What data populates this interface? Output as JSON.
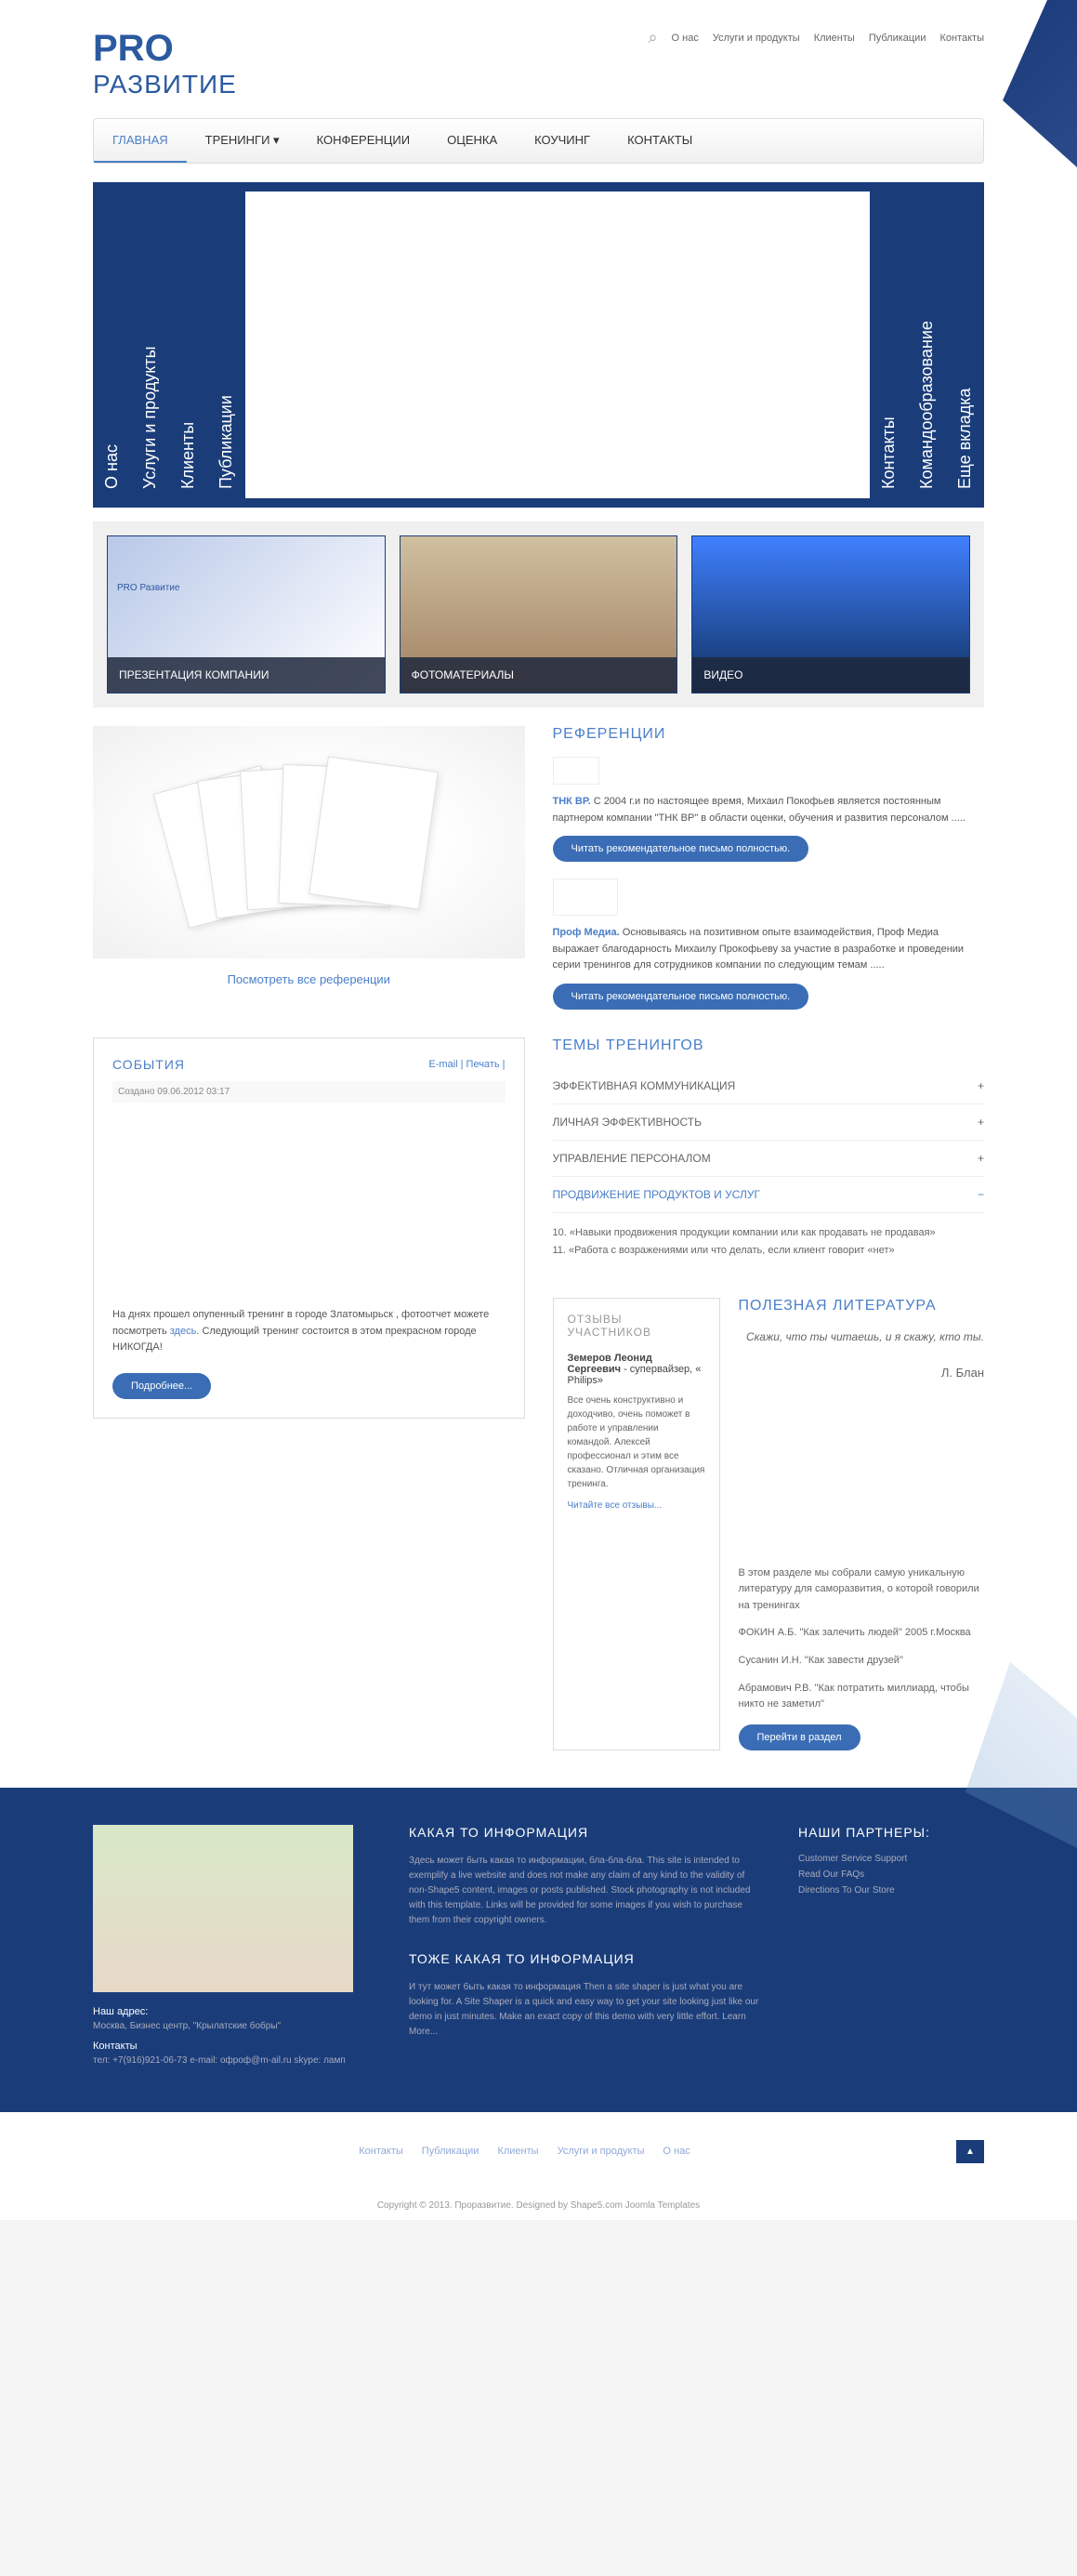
{
  "logo": {
    "main": "PRO",
    "sub": "РАЗВИТИЕ"
  },
  "topNav": [
    "О нас",
    "Услуги и продукты",
    "Клиенты",
    "Публикации",
    "Контакты"
  ],
  "mainNav": [
    {
      "label": "ГЛАВНАЯ",
      "active": true
    },
    {
      "label": "ТРЕНИНГИ ▾"
    },
    {
      "label": "КОНФЕРЕНЦИИ"
    },
    {
      "label": "ОЦЕНКА"
    },
    {
      "label": "КОУЧИНГ"
    },
    {
      "label": "КОНТАКТЫ"
    }
  ],
  "heroTabs": {
    "left": [
      "О нас",
      "Услуги и продукты",
      "Клиенты",
      "Публикации"
    ],
    "right": [
      "Контакты",
      "Командообразование",
      "Еще вкладка"
    ]
  },
  "cards": [
    {
      "title": "ПРЕЗЕНТАЦИЯ КОМПАНИИ",
      "sub": "PRO Развитие"
    },
    {
      "title": "ФОТОМАТЕРИАЛЫ"
    },
    {
      "title": "ВИДЕО"
    }
  ],
  "refSection": {
    "allLink": "Посмотреть все референции",
    "title": "РЕФЕРЕНЦИИ",
    "items": [
      {
        "name": "ТНК ВР.",
        "text": "С 2004 г.и по настоящее время, Михаил Покофьев является постоянным партнером компании \"ТНК ВР\" в области оценки, обучения и развития персоналом ....."
      },
      {
        "name": "Проф Медиа.",
        "text": "Основываясь на позитивном опыте взаимодействия, Проф Медиа выражает благодарность Михаилу Прокофьеву за участие в разработке и проведении серии тренингов для сотрудников компании по следующим темам ....."
      }
    ],
    "btnLabel": "Читать рекомендательное письмо полностью."
  },
  "events": {
    "title": "СОБЫТИЯ",
    "emailLink": "E-mail",
    "printLink": "Печать",
    "date": "Создано 09.06.2012 03:17",
    "text1": "На днях прошел опупенный тренинг в городе Златомырьск , фотоотчет можете посмотреть ",
    "textLink": "здесь",
    "text2": ". Следующий тренинг состоится в этом прекрасном городе НИКОГДА!",
    "moreBtn": "Подробнее..."
  },
  "trainings": {
    "title": "ТЕМЫ ТРЕНИНГОВ",
    "items": [
      {
        "label": "ЭФФЕКТИВНАЯ КОММУНИКАЦИЯ",
        "open": false
      },
      {
        "label": "ЛИЧНАЯ ЭФФЕКТИВНОСТЬ",
        "open": false
      },
      {
        "label": "УПРАВЛЕНИЕ ПЕРСОНАЛОМ",
        "open": false
      },
      {
        "label": "ПРОДВИЖЕНИЕ ПРОДУКТОВ И УСЛУГ",
        "open": true
      }
    ],
    "openContent": "10. «Навыки продвижения продукции компании или как продавать не продавая»\n11. «Работа с возражениями или что делать, если клиент говорит «нет»"
  },
  "feedback": {
    "title": "ОТЗЫВЫ УЧАСТНИКОВ",
    "name": "Земеров Леонид Сергеевич",
    "role": "- супервайзер, « Philips»",
    "text": "Все очень конструктивно и доходчиво, очень поможет в работе и управлении командой. Алексей профессионал и этим все сказано. Отличная организация тренинга.",
    "link": "Читайте все отзывы..."
  },
  "literature": {
    "title": "ПОЛЕЗНАЯ ЛИТЕРАТУРА",
    "quote": "Скажи, что ты читаешь, и я скажу, кто ты.",
    "author": "Л. Блан",
    "intro": "В этом разделе мы собрали самую уникальную литературу для саморазвития, о которой говорили на тренингах",
    "books": [
      "ФОКИН А.Б. \"Как залечить людей\" 2005 г.Москва",
      "Сусанин И.Н. \"Как завести друзей\"",
      "Абрамович Р.В. \"Как потратить миллиард, чтобы никто не заметил\""
    ],
    "btn": "Перейти в раздел"
  },
  "footer": {
    "info1Title": "КАКАЯ ТО ИНФОРМАЦИЯ",
    "info1Text": "Здесь может быть какая то информации, бла-бла-бла. This site is intended to exemplify a live website and does not make any claim of any kind to the validity of non-Shape5 content, images or posts published. Stock photography is not included with this template. Links will be provided for some images if you wish to purchase them from their copyright owners.",
    "info2Title": "ТОЖЕ КАКАЯ ТО ИНФОРМАЦИЯ",
    "info2Text": "И тут может быть какая то информация Then a site shaper is just what you are looking for. A Site Shaper is a quick and easy way to get your site looking just like our demo in just minutes. Make an exact copy of this demo with very little effort. Learn More...",
    "partnersTitle": "НАШИ ПАРТНЕРЫ:",
    "partnerLinks": [
      "Customer Service Support",
      "Read Our FAQs",
      "Directions To Our Store"
    ],
    "addrLabel": "Наш адрес:",
    "addr": "Москва, Бизнес центр, \"Крылатские бобры\"",
    "contactsLabel": "Контакты",
    "contacts": "тел: +7(916)921-06-73 e-mail: офроф@m-ail.ru skype: ламп"
  },
  "bottomNav": [
    "Контакты",
    "Публикации",
    "Клиенты",
    "Услуги и продукты",
    "О нас"
  ],
  "copyright": "Copyright © 2013. Проразвитие. Designed by Shape5.com Joomla Templates"
}
